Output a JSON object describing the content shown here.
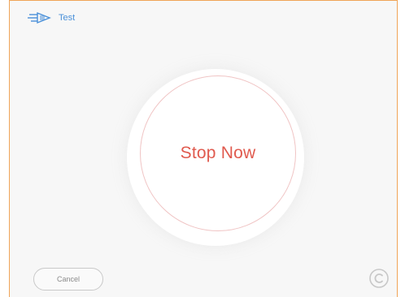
{
  "header": {
    "title": "Test",
    "icon": "fast-forward-speed-icon"
  },
  "main": {
    "stop_label": "Stop Now"
  },
  "footer": {
    "cancel_label": "Cancel",
    "corner_icon": "copyright-icon"
  },
  "colors": {
    "frame_border": "#f0a458",
    "accent_blue": "#4a90d9",
    "stop_red": "#e05a4e",
    "background": "#f7f7f7"
  }
}
